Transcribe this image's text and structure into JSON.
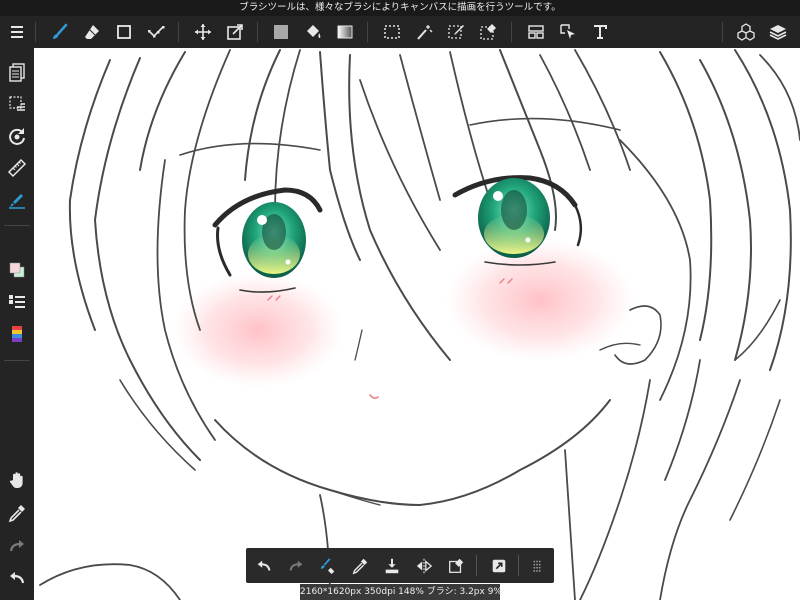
{
  "hint_bar": {
    "text": "ブラシツールは、様々なブラシによりキャンバスに描画を行うツールです。"
  },
  "top_toolbar": {
    "items": [
      "menu-icon",
      "brush-icon",
      "eraser-icon",
      "shape-icon",
      "edit-icon",
      "move-icon",
      "transform-icon",
      "fill-color-icon",
      "bucket-icon",
      "gradient-icon",
      "select-icon",
      "magic-wand-icon",
      "select-pen-icon",
      "select-eraser-icon",
      "frame-icon",
      "select-object-icon",
      "text-icon",
      "material-icon",
      "layers-icon"
    ]
  },
  "left_toolbar": {
    "items": [
      "pages-icon",
      "selection-icon",
      "rotate-icon",
      "ruler-icon",
      "snap-icon",
      "color-icon",
      "brush-list-icon",
      "palette-icon",
      "hand-icon",
      "eyedropper-icon",
      "redo-icon",
      "undo-icon"
    ]
  },
  "bottom_toolbar": {
    "items": [
      "undo-icon",
      "redo-icon",
      "brush-eraser-toggle-icon",
      "eyedropper-icon",
      "merge-down-icon",
      "flip-icon",
      "clear-icon",
      "property-icon",
      "grip-icon"
    ]
  },
  "status_bar": {
    "text": "2160*1620px 350dpi 148% ブラシ: 3.2px 9%"
  },
  "colors": {
    "toolbar_bg": "#242424",
    "active_blue": "#2e9bd6",
    "icon_color": "#e8e8e8",
    "eye_green": "#2aa87a",
    "blush_pink": "#ffb6bc"
  }
}
